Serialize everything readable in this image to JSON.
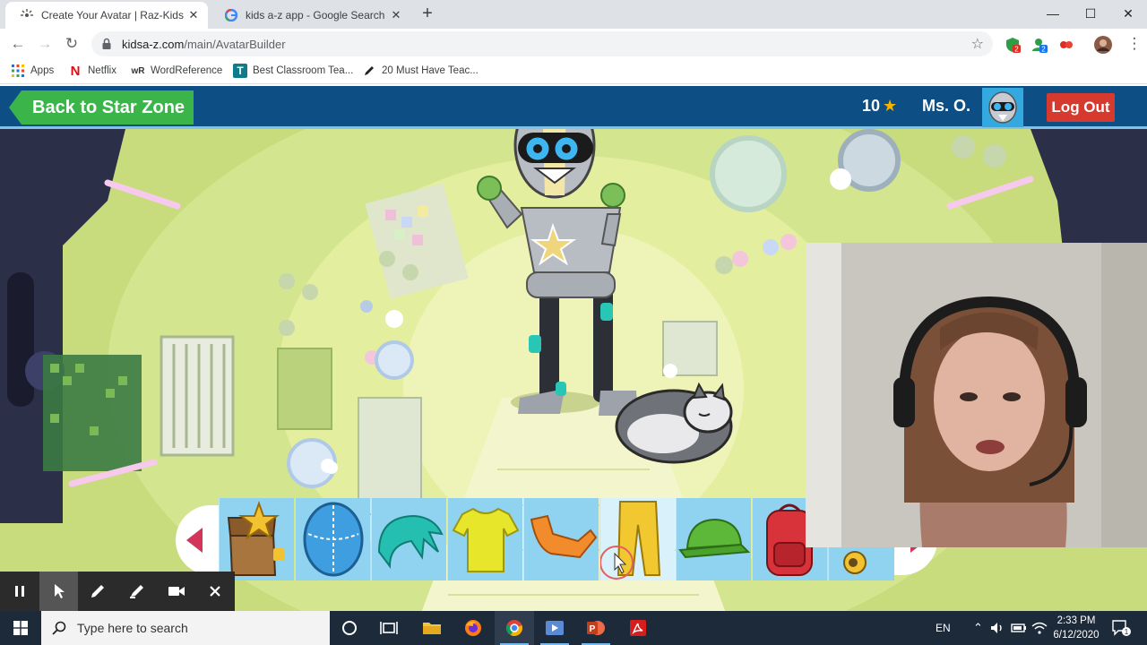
{
  "browser": {
    "tabs": [
      {
        "title": "Create Your Avatar | Raz-Kids | Ki",
        "active": true
      },
      {
        "title": "kids a-z app - Google Search",
        "active": false
      }
    ],
    "new_tab": "+",
    "window_controls": {
      "minimize": "—",
      "maximize": "☐",
      "close": "✕"
    },
    "url_host": "kidsa-z.com",
    "url_path": "/main/AvatarBuilder",
    "bookmarks": [
      {
        "label": "Apps",
        "icon": "apps-grid-icon"
      },
      {
        "label": "Netflix",
        "icon": "netflix-icon"
      },
      {
        "label": "WordReference",
        "icon": "wordreference-icon"
      },
      {
        "label": "Best Classroom Tea...",
        "icon": "teachers-icon"
      },
      {
        "label": "20 Must Have Teac...",
        "icon": "pen-icon"
      }
    ],
    "extension_badges": [
      "2",
      "2"
    ]
  },
  "app": {
    "back_label": "Back to Star Zone",
    "stars_count": "10",
    "teacher_name": "Ms. O.",
    "logout_label": "Log Out",
    "items": [
      {
        "name": "treasure-chest-item",
        "icon": "treasure-chest-icon"
      },
      {
        "name": "head-item",
        "icon": "helmet-icon"
      },
      {
        "name": "hair-item",
        "icon": "hair-icon"
      },
      {
        "name": "shirt-item",
        "icon": "shirt-icon"
      },
      {
        "name": "arm-item",
        "icon": "arm-icon"
      },
      {
        "name": "pants-item",
        "icon": "pants-icon",
        "selected": true
      },
      {
        "name": "hat-item",
        "icon": "cap-icon"
      },
      {
        "name": "backpack-item",
        "icon": "backpack-icon"
      },
      {
        "name": "pet-item",
        "icon": "paw-icon"
      }
    ],
    "colors": {
      "header": "#0d4f84",
      "back_button": "#3bb54a",
      "logout_button": "#d63a2f",
      "star": "#f5b400"
    }
  },
  "taskbar": {
    "search_placeholder": "Type here to search",
    "language": "EN",
    "time": "2:33 PM",
    "date": "6/12/2020",
    "notification_badge": "1"
  }
}
